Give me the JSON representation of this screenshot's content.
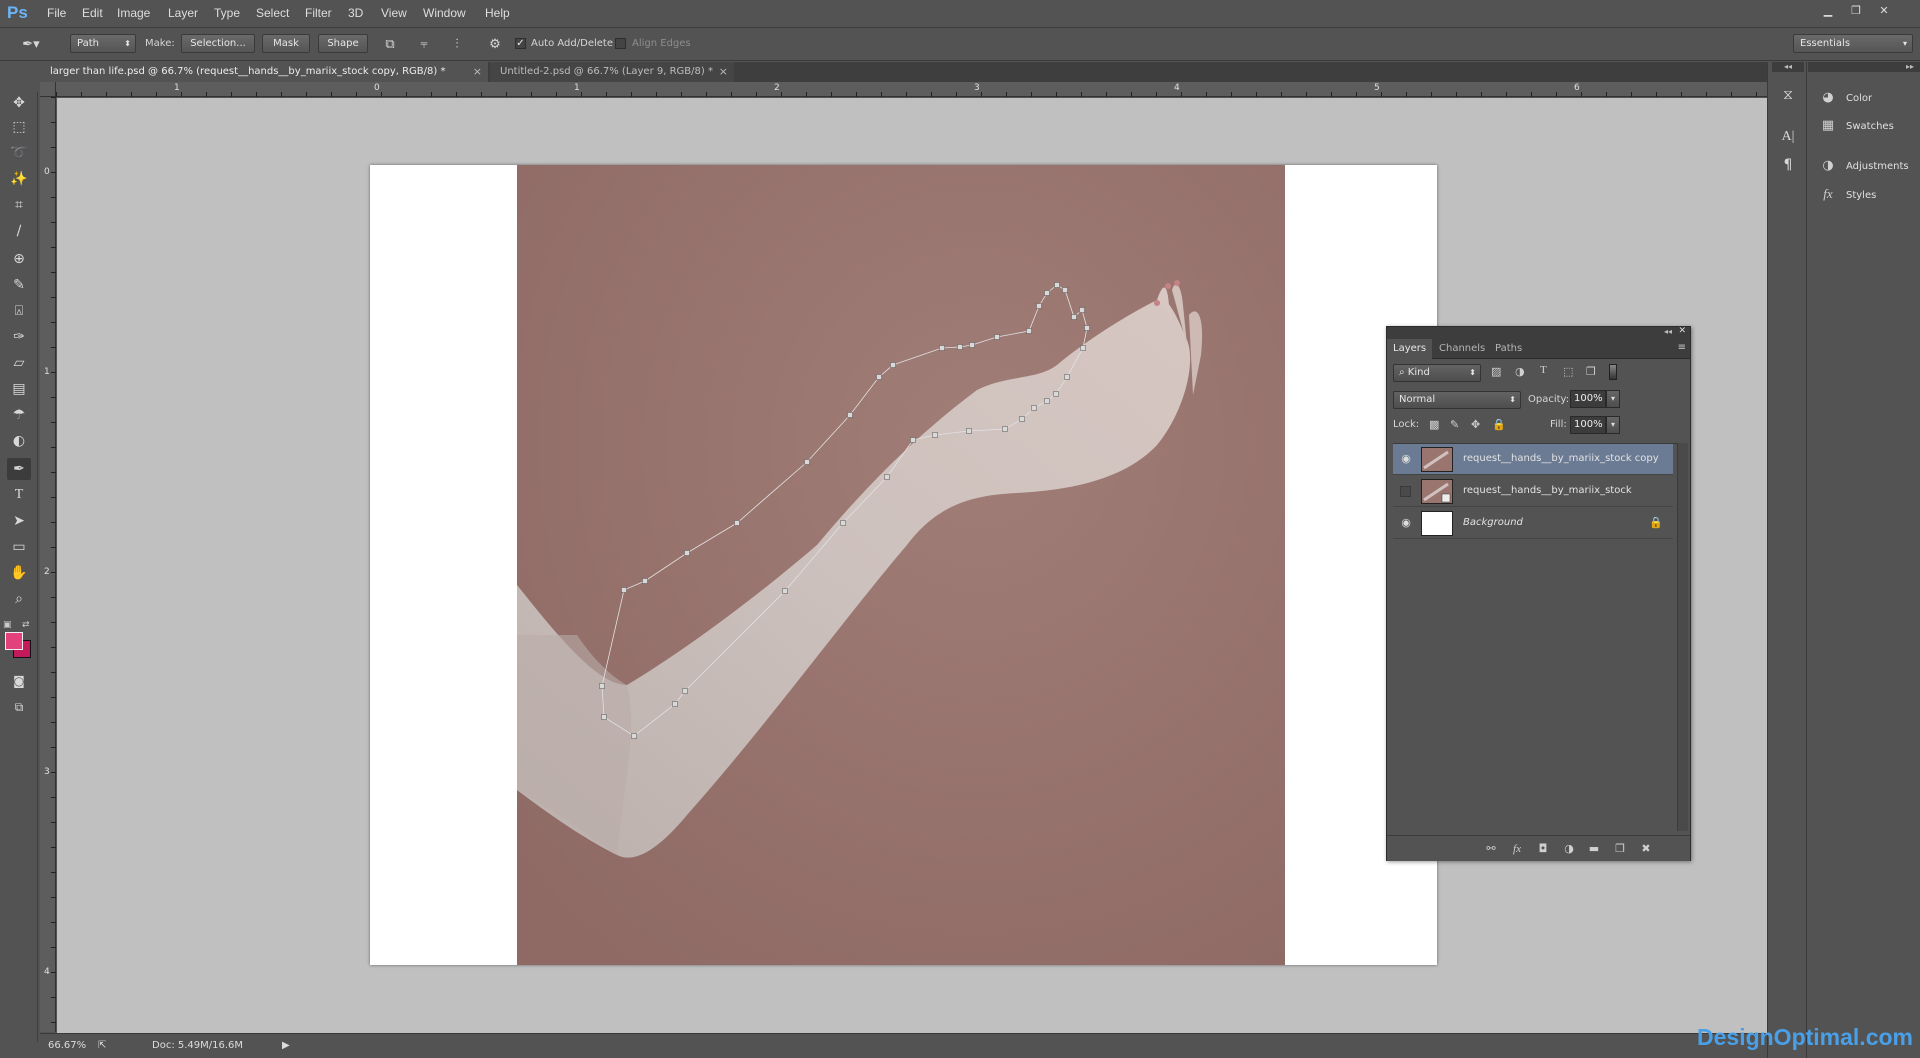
{
  "app": {
    "logo": "Ps"
  },
  "menu": [
    "File",
    "Edit",
    "Image",
    "Layer",
    "Type",
    "Select",
    "Filter",
    "3D",
    "View",
    "Window",
    "Help"
  ],
  "window_controls": [
    "minimize-icon",
    "restore-icon",
    "close-icon"
  ],
  "options": {
    "tool_mode": "Path",
    "make_label": "Make:",
    "selection_button": "Selection...",
    "mask_button": "Mask",
    "shape_button": "Shape",
    "auto_add_delete": {
      "label": "Auto Add/Delete",
      "checked": true
    },
    "align_edges": {
      "label": "Align Edges",
      "checked": false
    },
    "workspace": "Essentials"
  },
  "tabs": [
    {
      "title": "larger than life.psd @ 66.7% (request__hands__by_mariix_stock copy, RGB/8) *",
      "active": true
    },
    {
      "title": "Untitled-2.psd @ 66.7% (Layer 9, RGB/8) *",
      "active": false
    }
  ],
  "rulers": {
    "h_ticks": [
      "1",
      "0",
      "1",
      "2",
      "3",
      "4",
      "5",
      "6"
    ],
    "v_ticks": [
      "0",
      "1",
      "2",
      "3",
      "4"
    ]
  },
  "colors": {
    "foreground": "#e2417c",
    "background": "#c21a5a",
    "photo_bg": "#9a7570",
    "selected_layer": "#6c7b94"
  },
  "status": {
    "zoom": "66.67%",
    "doc": "Doc: 5.49M/16.6M"
  },
  "right_panels": [
    {
      "label": "Color",
      "icon": "palette-icon"
    },
    {
      "label": "Swatches",
      "icon": "grid-icon"
    },
    {
      "label": "Adjustments",
      "icon": "half-circle-icon"
    },
    {
      "label": "Styles",
      "icon": "fx-icon"
    }
  ],
  "layers_panel": {
    "tabs": [
      "Layers",
      "Channels",
      "Paths"
    ],
    "filter": "Kind",
    "blend_mode": "Normal",
    "opacity_label": "Opacity:",
    "opacity": "100%",
    "lock_label": "Lock:",
    "fill_label": "Fill:",
    "fill": "100%",
    "layers": [
      {
        "name": "request__hands__by_mariix_stock copy",
        "visible": true,
        "selected": true
      },
      {
        "name": "request__hands__by_mariix_stock",
        "visible": false,
        "selected": false
      },
      {
        "name": "Background",
        "visible": true,
        "selected": false,
        "locked": true
      }
    ]
  },
  "watermark": "DesignOptimal.com"
}
